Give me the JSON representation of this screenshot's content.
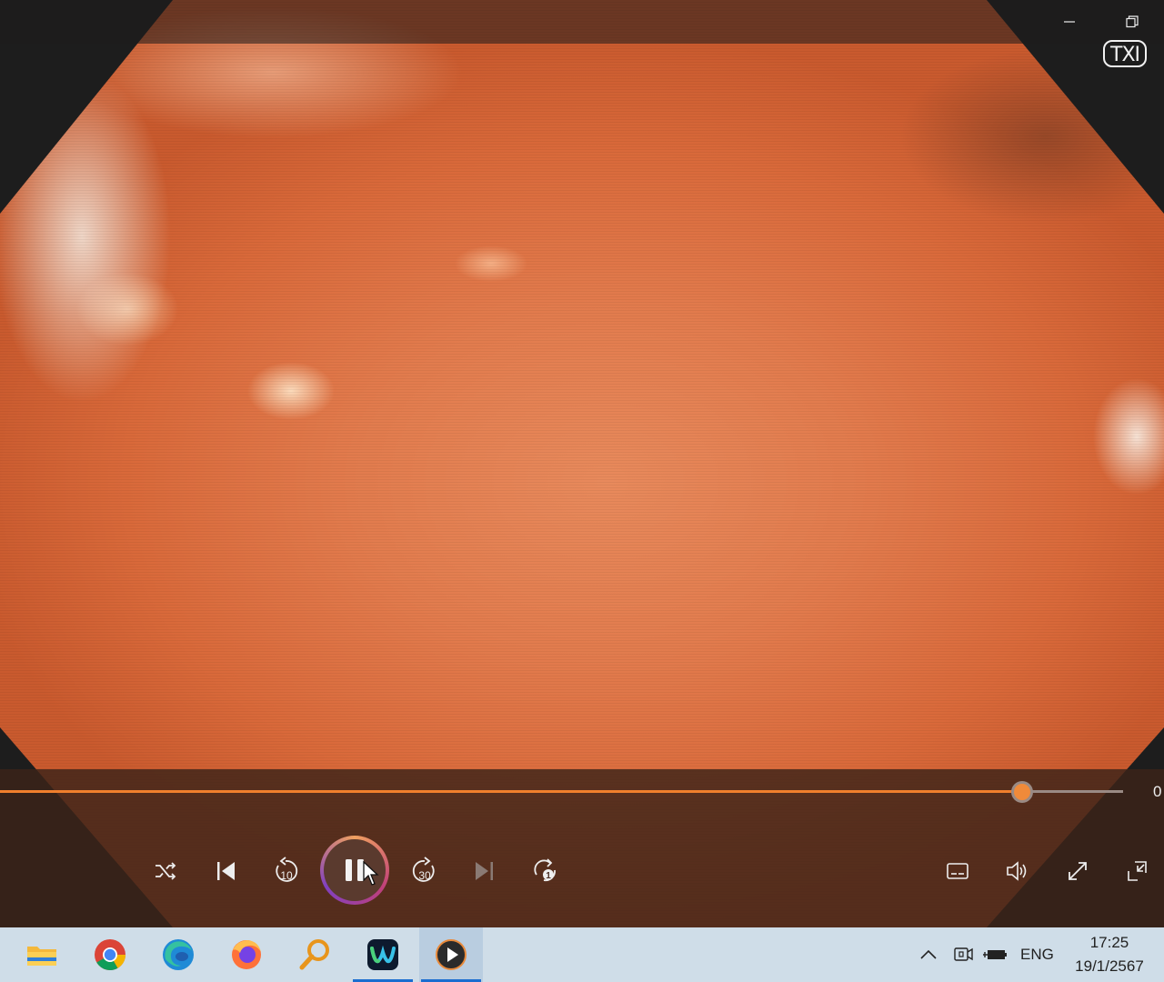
{
  "window": {
    "controls": [
      "minimize-icon",
      "restore-icon"
    ]
  },
  "video": {
    "overlay_label": "TXI"
  },
  "player": {
    "seek_progress": 0.91,
    "time_end": "0",
    "accent_color": "#f07f2d",
    "skip_back_label": "10",
    "skip_forward_label": "30",
    "repeat_label": "1",
    "state": "playing"
  },
  "taskbar": {
    "apps": [
      "file-explorer",
      "chrome",
      "edge",
      "firefox",
      "search-tool",
      "webex",
      "media-player"
    ],
    "language": "ENG",
    "time": "17:25",
    "date": "19/1/2567"
  }
}
